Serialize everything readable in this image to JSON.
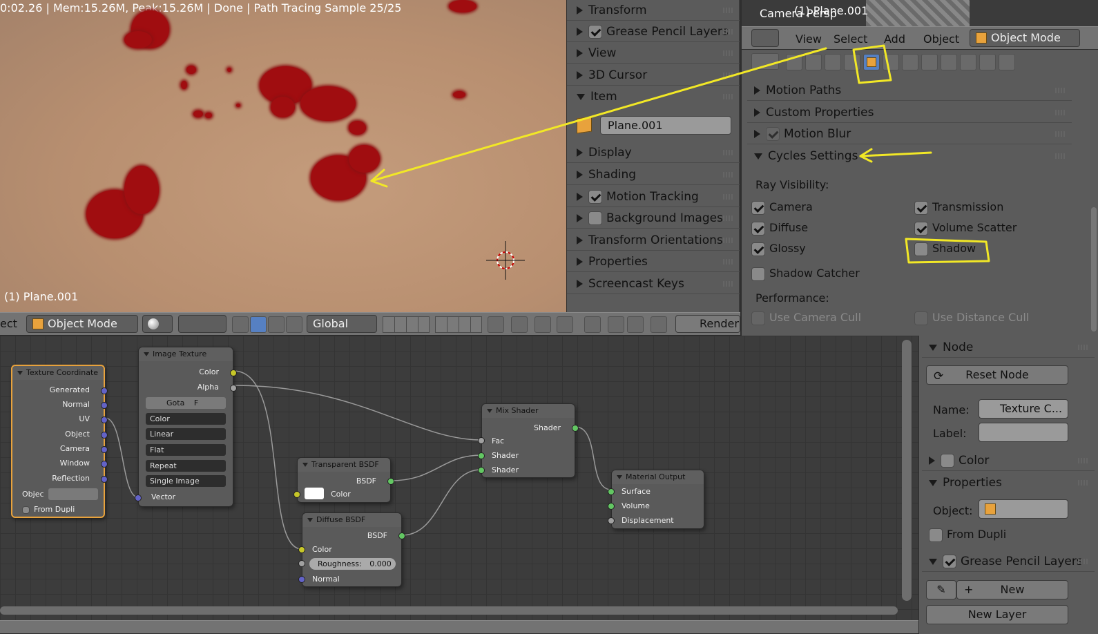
{
  "viewport": {
    "status": "0:02.26 | Mem:15.26M, Peak:15.26M | Done | Path Tracing Sample 25/25",
    "object_label": "(1) Plane.001"
  },
  "npanel": {
    "rows": [
      "Transform",
      "Grease Pencil Layers",
      "View",
      "3D Cursor",
      "Item",
      "Display",
      "Shading",
      "Motion Tracking",
      "Background Images",
      "Transform Orientations",
      "Properties",
      "Screencast Keys"
    ],
    "item_name": "Plane.001"
  },
  "viewport_header": {
    "menu_left": "ect",
    "mode": "Object Mode",
    "orientation": "Global",
    "render": "Render"
  },
  "mini_view": {
    "title": "Camera Persp",
    "object": "(1) Plane.001"
  },
  "props_header": {
    "menus": [
      "View",
      "Select",
      "Add",
      "Object"
    ],
    "mode": "Object Mode"
  },
  "props": {
    "panels": [
      "Motion Paths",
      "Custom Properties",
      "Motion Blur",
      "Cycles Settings"
    ],
    "ray_visibility_label": "Ray Visibility:",
    "camera": "Camera",
    "diffuse": "Diffuse",
    "glossy": "Glossy",
    "transmission": "Transmission",
    "volume_scatter": "Volume Scatter",
    "shadow": "Shadow",
    "shadow_catcher": "Shadow Catcher",
    "performance_label": "Performance:",
    "use_camera_cull": "Use Camera Cull",
    "use_distance_cull": "Use Distance Cull"
  },
  "nodes": {
    "tex_coord": {
      "title": "Texture Coordinate",
      "outputs": [
        "Generated",
        "Normal",
        "UV",
        "Object",
        "Camera",
        "Window",
        "Reflection"
      ],
      "object_label": "Objec",
      "from_dupli": "From Dupli"
    },
    "image_texture": {
      "title": "Image Texture",
      "outputs": [
        "Color",
        "Alpha"
      ],
      "image": "Gota",
      "image_f": "F",
      "options": [
        "Color",
        "Linear",
        "Flat",
        "Repeat",
        "Single Image"
      ],
      "input": "Vector"
    },
    "transparent": {
      "title": "Transparent BSDF",
      "output": "BSDF",
      "input": "Color"
    },
    "diffuse": {
      "title": "Diffuse BSDF",
      "output": "BSDF",
      "color": "Color",
      "roughness": "Roughness:",
      "roughness_value": "0.000",
      "normal": "Normal"
    },
    "mix": {
      "title": "Mix Shader",
      "output": "Shader",
      "inputs": [
        "Fac",
        "Shader",
        "Shader"
      ]
    },
    "output": {
      "title": "Material Output",
      "inputs": [
        "Surface",
        "Volume",
        "Displacement"
      ]
    }
  },
  "node_sidebar": {
    "node_panel": "Node",
    "reset": "Reset Node",
    "name_label": "Name:",
    "name_value": "Texture C...",
    "label_label": "Label:",
    "color_panel": "Color",
    "properties_panel": "Properties",
    "object_label": "Object:",
    "from_dupli": "From Dupli",
    "gp_panel": "Grease Pencil Layers",
    "new": "New",
    "new_layer": "New Layer"
  },
  "colors": {
    "annotation": "#f2e826",
    "blood": "#a00d10",
    "node_selected": "#e8a23c"
  }
}
